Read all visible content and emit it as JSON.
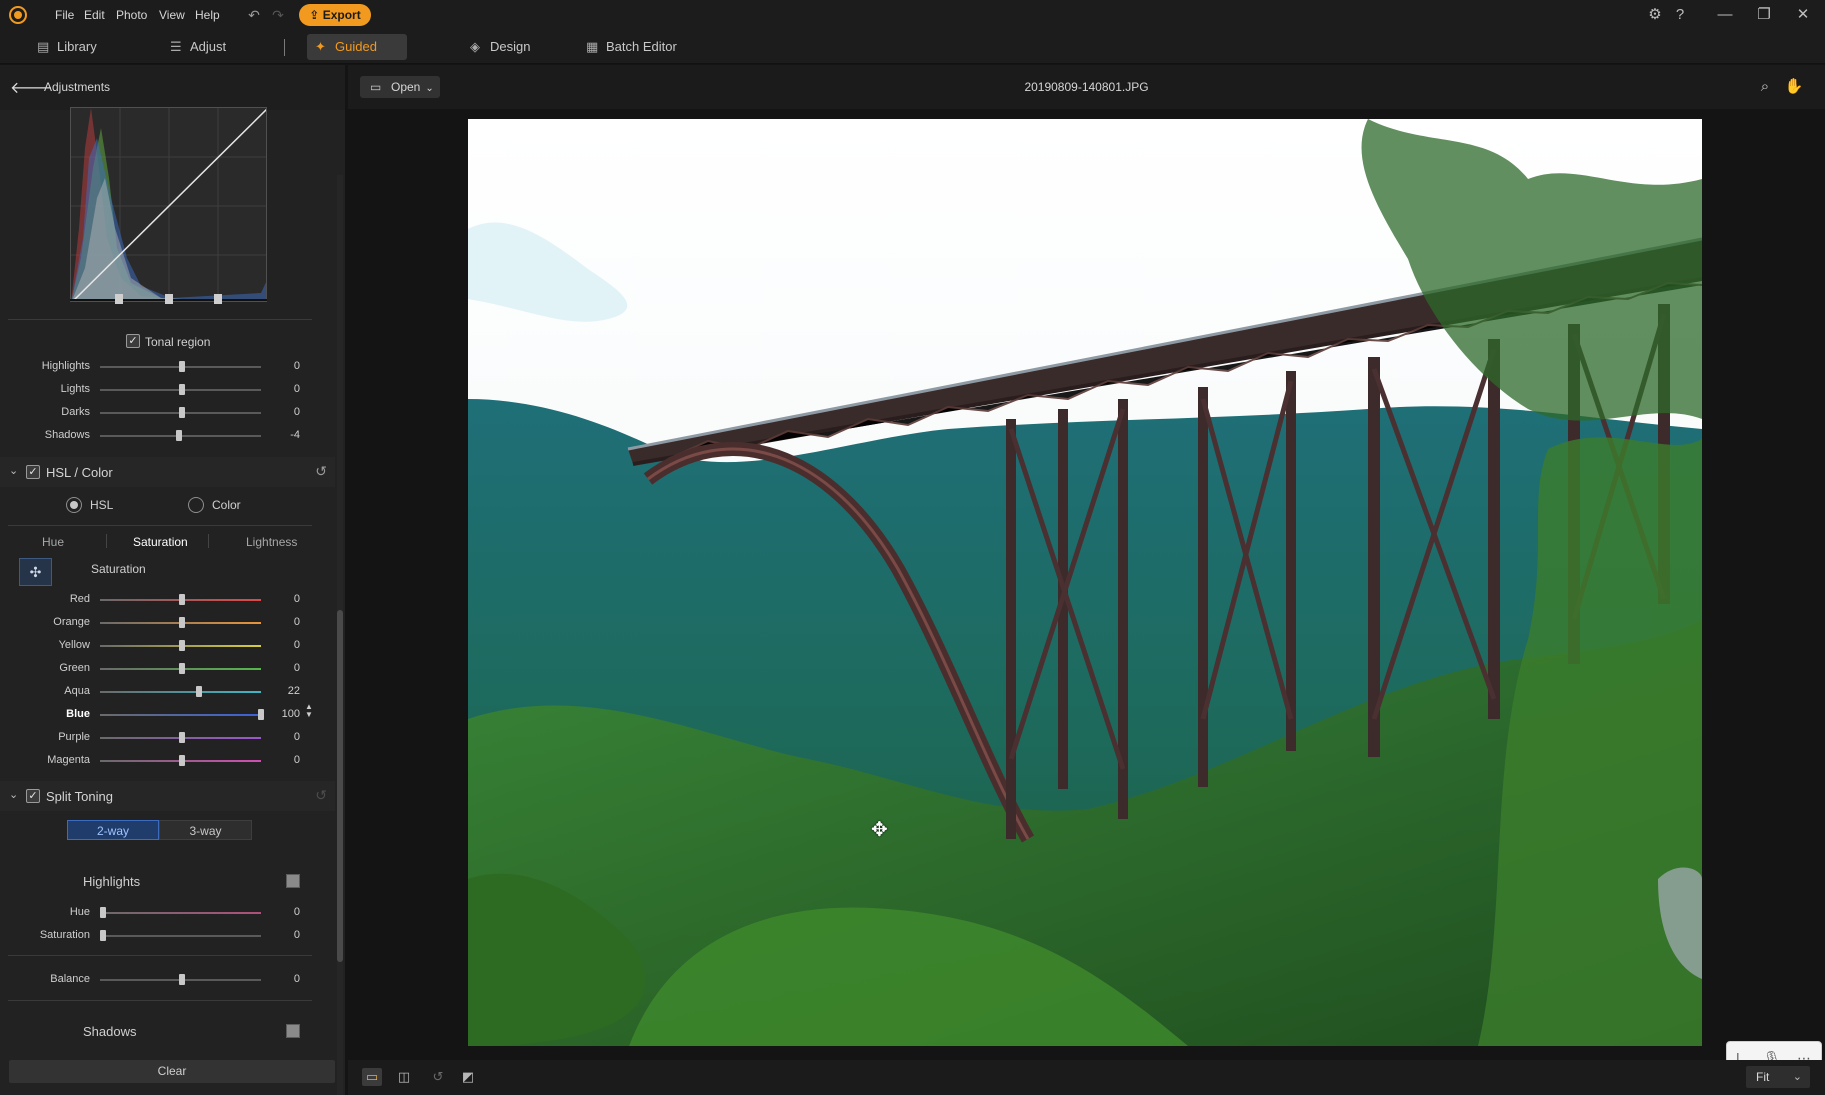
{
  "app": {
    "menu": [
      "File",
      "Edit",
      "Photo",
      "View",
      "Help"
    ],
    "export_label": "Export",
    "undo_icon": "undo-icon",
    "redo_icon": "redo-icon"
  },
  "tabs": [
    {
      "label": "Library",
      "icon": "library-icon"
    },
    {
      "label": "Adjust",
      "icon": "sliders-icon"
    },
    {
      "label": "Guided",
      "icon": "wand-icon",
      "active": true
    },
    {
      "label": "Design",
      "icon": "layers-icon"
    },
    {
      "label": "Batch Editor",
      "icon": "batch-icon"
    }
  ],
  "panel": {
    "title": "Adjustments",
    "tonal_region_label": "Tonal region",
    "tonal_sliders": [
      {
        "label": "Highlights",
        "value": "0",
        "pos": 0.5
      },
      {
        "label": "Lights",
        "value": "0",
        "pos": 0.5
      },
      {
        "label": "Darks",
        "value": "0",
        "pos": 0.5
      },
      {
        "label": "Shadows",
        "value": "-4",
        "pos": 0.48
      }
    ],
    "hsl_section": {
      "title": "HSL / Color",
      "modes": [
        "HSL",
        "Color"
      ],
      "selected_mode": "HSL",
      "subtabs": [
        "Hue",
        "Saturation",
        "Lightness"
      ],
      "active_subtab": "Saturation",
      "group_label": "Saturation",
      "sliders": [
        {
          "label": "Red",
          "value": "0",
          "pos": 0.5,
          "color": "#e04848"
        },
        {
          "label": "Orange",
          "value": "0",
          "pos": 0.5,
          "color": "#e8953a"
        },
        {
          "label": "Yellow",
          "value": "0",
          "pos": 0.5,
          "color": "#d8cf3c"
        },
        {
          "label": "Green",
          "value": "0",
          "pos": 0.5,
          "color": "#55b84a"
        },
        {
          "label": "Aqua",
          "value": "22",
          "pos": 0.61,
          "color": "#3cb8c6"
        },
        {
          "label": "Blue",
          "value": "100",
          "pos": 1.0,
          "color": "#3a62d8",
          "active": true
        },
        {
          "label": "Purple",
          "value": "0",
          "pos": 0.5,
          "color": "#9b56cf"
        },
        {
          "label": "Magenta",
          "value": "0",
          "pos": 0.5,
          "color": "#d14eb3"
        }
      ]
    },
    "split_toning": {
      "title": "Split Toning",
      "modes": [
        "2-way",
        "3-way"
      ],
      "active_mode": "2-way",
      "highlights_label": "Highlights",
      "highlights_sliders": [
        {
          "label": "Hue",
          "value": "0",
          "pos": 0.0
        },
        {
          "label": "Saturation",
          "value": "0",
          "pos": 0.0
        }
      ],
      "balance": {
        "label": "Balance",
        "value": "0",
        "pos": 0.5
      },
      "shadows_label": "Shadows"
    },
    "clear_label": "Clear"
  },
  "viewer": {
    "open_label": "Open",
    "filename": "20190809-140801.JPG",
    "zoom_label": "Fit",
    "tools": [
      "search-icon",
      "hand-icon"
    ]
  }
}
